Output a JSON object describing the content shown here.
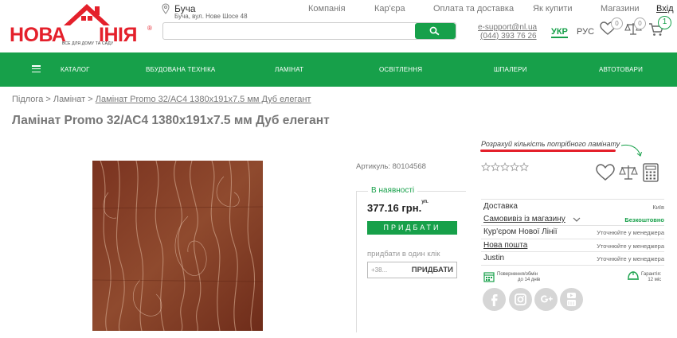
{
  "logo": {
    "word_left": "НОВА",
    "word_right": "ІНІЯ",
    "word_mark": "®",
    "tagline": "ВСЕ ДЛЯ ДОМУ ТА САДУ"
  },
  "location": {
    "city": "Буча",
    "address": "Буча, вул. Нове Шосе 48"
  },
  "top_links": [
    "Компанія",
    "Кар'єра",
    "Оплата та доставка",
    "Як купити",
    "Магазини",
    "Вхід"
  ],
  "search": {
    "placeholder": ""
  },
  "contacts": {
    "email": "e-support@nl.ua",
    "phone": "(044) 393 76 26"
  },
  "languages": {
    "active": "УКР",
    "other": "РУС"
  },
  "counters": {
    "favorites": "0",
    "compare": "0",
    "cart": "1"
  },
  "nav": {
    "items": [
      "Каталог",
      "Вбудована техніка",
      "Ламінат",
      "Освітлення",
      "Шпалери",
      "Автотовари"
    ]
  },
  "breadcrumb": {
    "items": [
      "Підлога",
      "Ламінат",
      "Ламінат Promo 32/АС4 1380х191х7.5 мм Дуб елегант"
    ],
    "separator": ">"
  },
  "product": {
    "title": "Ламінат Promo 32/АС4 1380х191х7.5 мм Дуб елегант",
    "article": "Артикуль: 80104568",
    "stock_status": "В наявності",
    "price": "377.16 грн.",
    "price_unit": "уп.",
    "buy_label": "ПРИДБАТИ",
    "one_click_label": "придбати в один клік",
    "phone_placeholder": "+38...",
    "one_click_button": "ПРИДБАТИ",
    "rating": 0
  },
  "calculator": {
    "link": "Розрахуй кількість потрібного ламінату"
  },
  "delivery": [
    {
      "label": "Доставка",
      "value": "Київ",
      "underline": false
    },
    {
      "label": "Самовивіз із магазину",
      "value": "Безкоштовно",
      "underline": true
    },
    {
      "label": "Кур'єром Нової Лінії",
      "value": "Уточнюйте у менеджера",
      "underline": false
    },
    {
      "label": "Нова пошта",
      "value": "Уточнюйте у менеджера",
      "underline": true
    },
    {
      "label": "Justin",
      "value": "Уточнюйте у менеджера",
      "underline": false
    }
  ],
  "guarantees": {
    "return_line1": "Повернення/обмін",
    "return_line2": "до 14 днів",
    "warranty_line1": "Гарантія:",
    "warranty_line2": "12 міс"
  },
  "social": [
    "facebook-icon",
    "instagram-icon",
    "google-plus-icon",
    "youtube-icon"
  ],
  "colors": {
    "brand_green": "#17a04a",
    "brand_red": "#e4202b"
  }
}
